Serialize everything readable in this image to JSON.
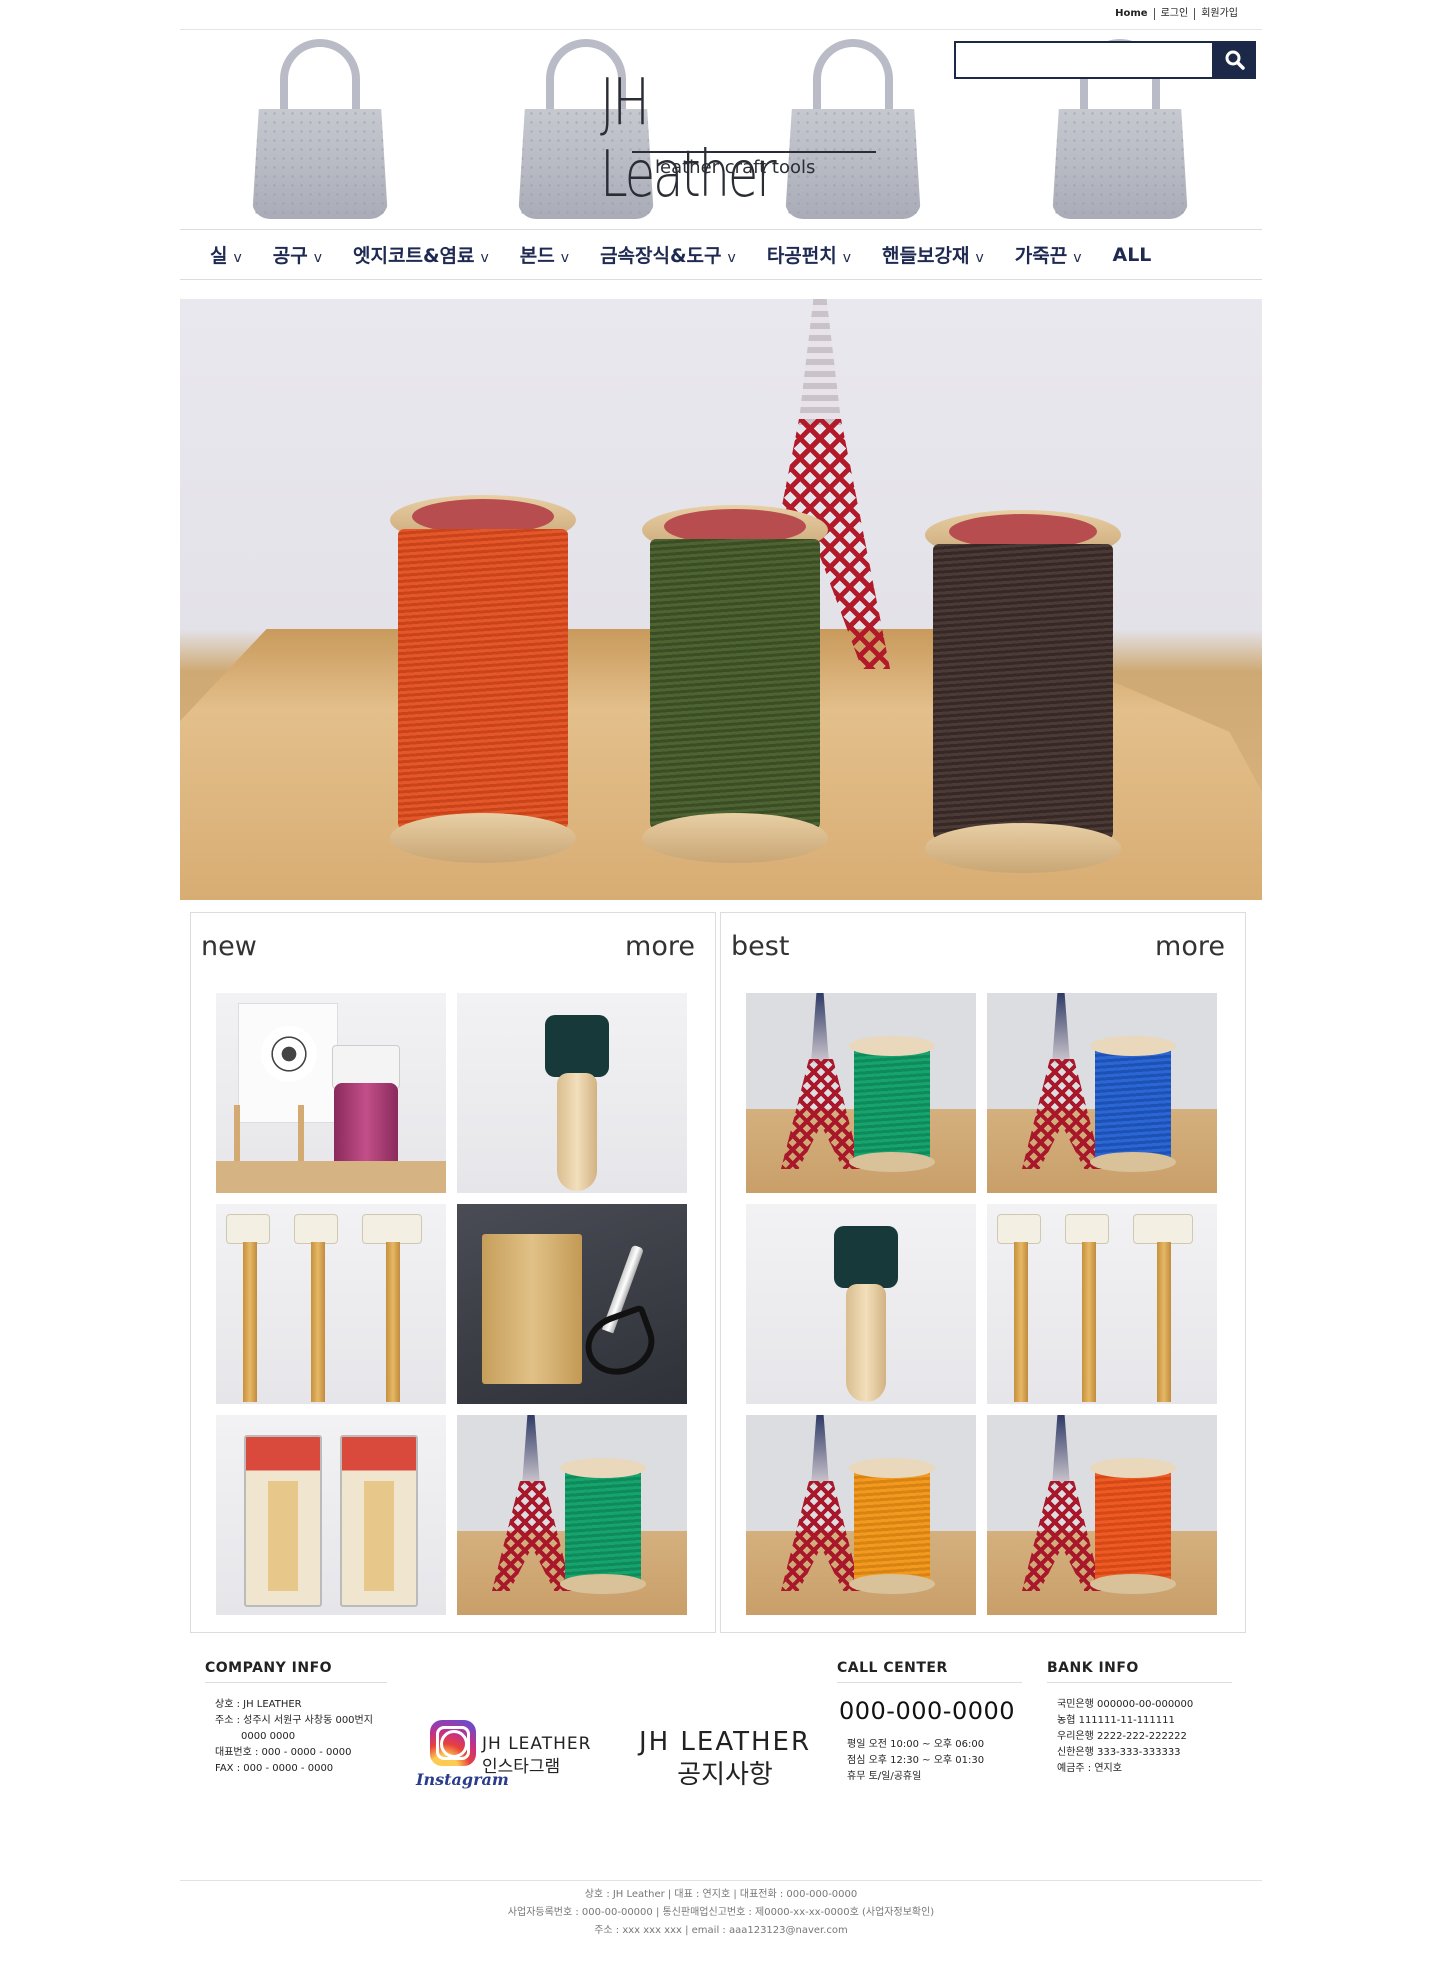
{
  "top_links": [
    "Home",
    "로그인",
    "회원가입"
  ],
  "logo": {
    "name": "JH Leather",
    "tagline": "leather craft tools"
  },
  "search": {
    "placeholder": "",
    "icon": "search-icon"
  },
  "nav": {
    "items": [
      {
        "label": "실",
        "arrow": "v"
      },
      {
        "label": "공구",
        "arrow": "v"
      },
      {
        "label": "엣지코트&염료",
        "arrow": "v"
      },
      {
        "label": "본드",
        "arrow": "v"
      },
      {
        "label": "금속장식&도구",
        "arrow": "v"
      },
      {
        "label": "타공펀치",
        "arrow": "v"
      },
      {
        "label": "핸들보강재",
        "arrow": "v"
      },
      {
        "label": "가죽끈",
        "arrow": "v"
      },
      {
        "label": "ALL",
        "arrow": ""
      }
    ]
  },
  "new_section": {
    "title": "new",
    "more": "more"
  },
  "best_section": {
    "title": "best",
    "more": "more"
  },
  "footer": {
    "company_info": {
      "heading": "COMPANY INFO",
      "lines": [
        "상호 : JH LEATHER",
        "주소 : 성주시 서원구 사창동 000번지",
        "0000 0000",
        "대표번호 : 000 - 0000 - 0000",
        "FAX : 000 - 0000 - 0000"
      ]
    },
    "instagram": {
      "word": "Instagram",
      "line1": "JH LEATHER",
      "line2": "인스타그램"
    },
    "notice": {
      "line1": "JH LEATHER",
      "line2": "공지사항"
    },
    "call_center": {
      "heading": "CALL CENTER",
      "phone": "000-000-0000",
      "lines": [
        "평일  오전 10:00 ~ 오후 06:00",
        "점심  오후 12:30 ~ 오후 01:30",
        "휴무  토/일/공휴일"
      ]
    },
    "bank_info": {
      "heading": "BANK INFO",
      "lines": [
        "국민은행 000000-00-000000",
        "농협 111111-11-111111",
        "우리은행 2222-222-222222",
        "신한은행 333-333-333333",
        "예금주 : 연지호"
      ]
    },
    "copyright": [
      "상호 : JH Leather | 대표 : 연지호 | 대표전화 : 000-000-0000",
      "사업자등록번호 : 000-00-00000 | 통신판매업신고번호 : 제0000-xx-xx-0000호 (사업자정보확인)",
      "주소 : xxx xxx xxx | email : aaa123123@naver.com"
    ]
  }
}
